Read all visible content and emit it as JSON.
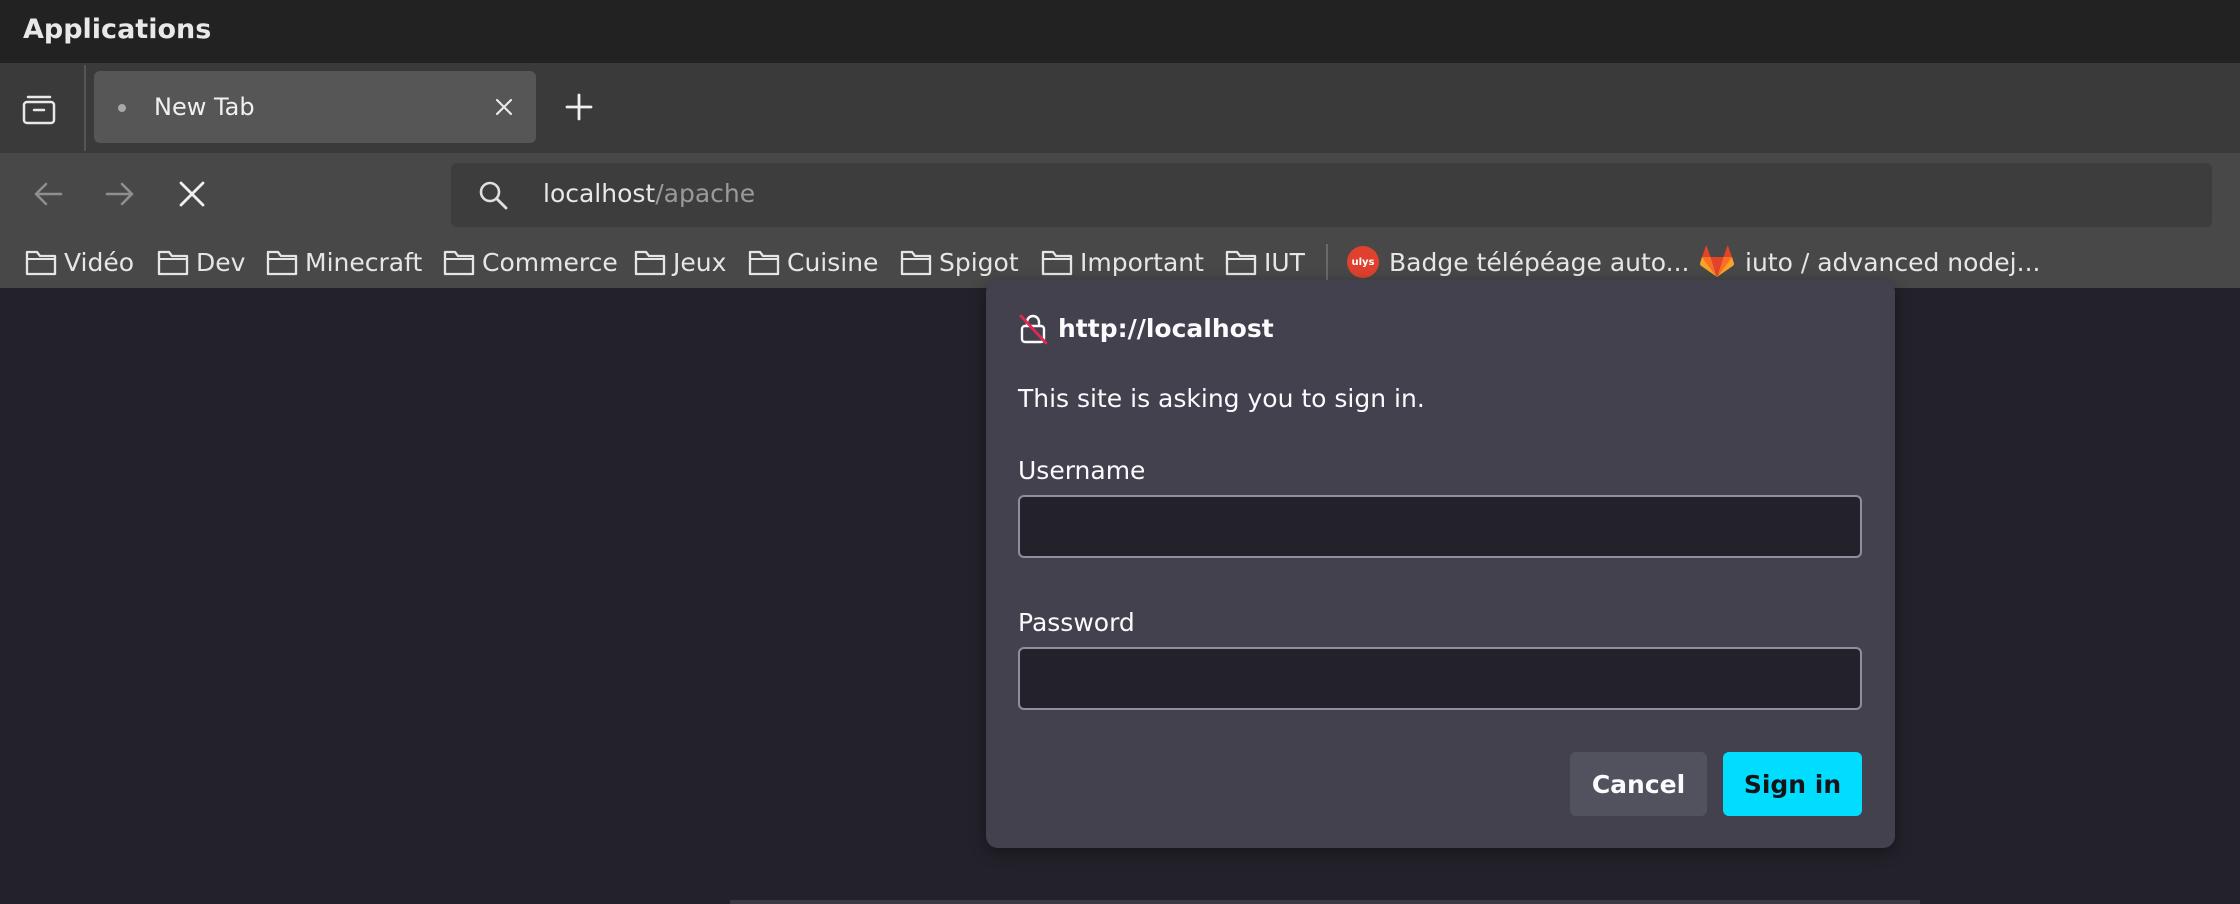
{
  "topbar": {
    "title": "Applications"
  },
  "tabs": [
    {
      "label": "New Tab"
    }
  ],
  "urlbar": {
    "host": "localhost",
    "path": "/apache"
  },
  "bookmarks": [
    {
      "label": "Vidéo",
      "icon": "folder-icon"
    },
    {
      "label": "Dev",
      "icon": "folder-icon"
    },
    {
      "label": "Minecraft",
      "icon": "folder-icon"
    },
    {
      "label": "Commerce",
      "icon": "folder-icon"
    },
    {
      "label": "Jeux",
      "icon": "folder-icon"
    },
    {
      "label": "Cuisine",
      "icon": "folder-icon"
    },
    {
      "label": "Spigot",
      "icon": "folder-icon"
    },
    {
      "label": "Important",
      "icon": "folder-icon"
    },
    {
      "label": "IUT",
      "icon": "folder-icon"
    },
    {
      "label": "Badge télépéage auto...",
      "icon": "ulys-badge-icon",
      "icon_text": "ulys"
    },
    {
      "label": "iuto / advanced nodej...",
      "icon": "gitlab-icon"
    }
  ],
  "dialog": {
    "host": "http://localhost",
    "message": "This site is asking you to sign in.",
    "username_label": "Username",
    "username_value": "",
    "password_label": "Password",
    "password_value": "",
    "cancel_label": "Cancel",
    "signin_label": "Sign in"
  },
  "colors": {
    "accent": "#00ddff",
    "dialog_bg": "#42414d",
    "page_bg": "#23222b",
    "insecure_lock": "#e22850"
  }
}
